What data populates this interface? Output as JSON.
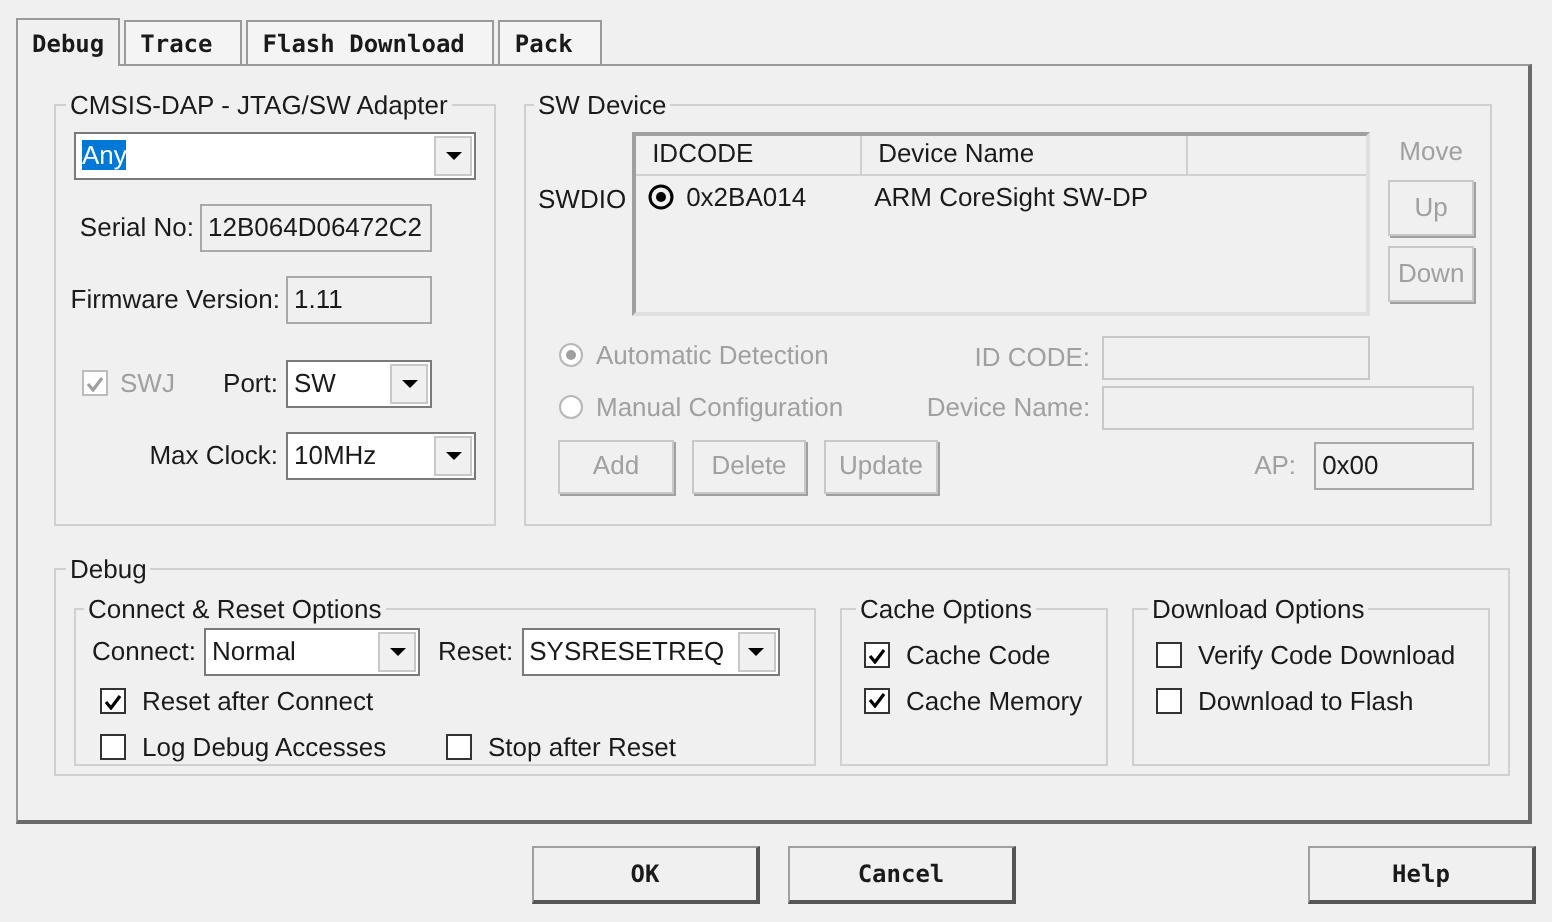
{
  "tabs": [
    {
      "label": "Debug",
      "selected": true
    },
    {
      "label": "Trace",
      "selected": false
    },
    {
      "label": "Flash Download",
      "selected": false
    },
    {
      "label": "Pack",
      "selected": false
    }
  ],
  "adapter": {
    "title": "CMSIS-DAP - JTAG/SW Adapter",
    "selection": "Any",
    "serial_label": "Serial No:",
    "serial": "12B064D06472C2",
    "firmware_label": "Firmware Version:",
    "firmware": "1.11",
    "swj": {
      "label": "SWJ",
      "checked": true,
      "disabled": true
    },
    "port_label": "Port:",
    "port": "SW",
    "clock_label": "Max Clock:",
    "clock": "10MHz"
  },
  "sw_device": {
    "title": "SW Device",
    "row_label": "SWDIO",
    "columns": [
      "IDCODE",
      "Device Name"
    ],
    "rows": [
      {
        "idcode": "0x2BA014",
        "device_name": "ARM CoreSight SW-DP",
        "selected": true
      }
    ],
    "move_label": "Move",
    "move_buttons": [
      {
        "label": "Up",
        "disabled": true
      },
      {
        "label": "Down",
        "disabled": true
      }
    ],
    "modes": [
      {
        "label": "Automatic Detection",
        "selected": true,
        "disabled": true
      },
      {
        "label": "Manual Configuration",
        "selected": false,
        "disabled": true
      }
    ],
    "id_code_label": "ID CODE:",
    "device_name_label": "Device Name:",
    "actions": [
      {
        "label": "Add",
        "disabled": true
      },
      {
        "label": "Delete",
        "disabled": true
      },
      {
        "label": "Update",
        "disabled": true
      }
    ],
    "ap_label": "AP:",
    "ap": "0x00"
  },
  "debug": {
    "title": "Debug",
    "connect_reset": {
      "title": "Connect & Reset Options",
      "connect_label": "Connect:",
      "connect": "Normal",
      "reset_label": "Reset:",
      "reset": "SYSRESETREQ",
      "options": [
        {
          "label": "Reset after Connect",
          "checked": true
        },
        {
          "label": "Log Debug Accesses",
          "checked": false
        },
        {
          "label": "Stop after Reset",
          "checked": false
        }
      ]
    },
    "cache": {
      "title": "Cache Options",
      "options": [
        {
          "label": "Cache Code",
          "checked": true
        },
        {
          "label": "Cache Memory",
          "checked": true
        }
      ]
    },
    "download": {
      "title": "Download Options",
      "options": [
        {
          "label": "Verify Code Download",
          "checked": false
        },
        {
          "label": "Download to Flash",
          "checked": false
        }
      ]
    }
  },
  "buttons": [
    "OK",
    "Cancel",
    "Help"
  ]
}
